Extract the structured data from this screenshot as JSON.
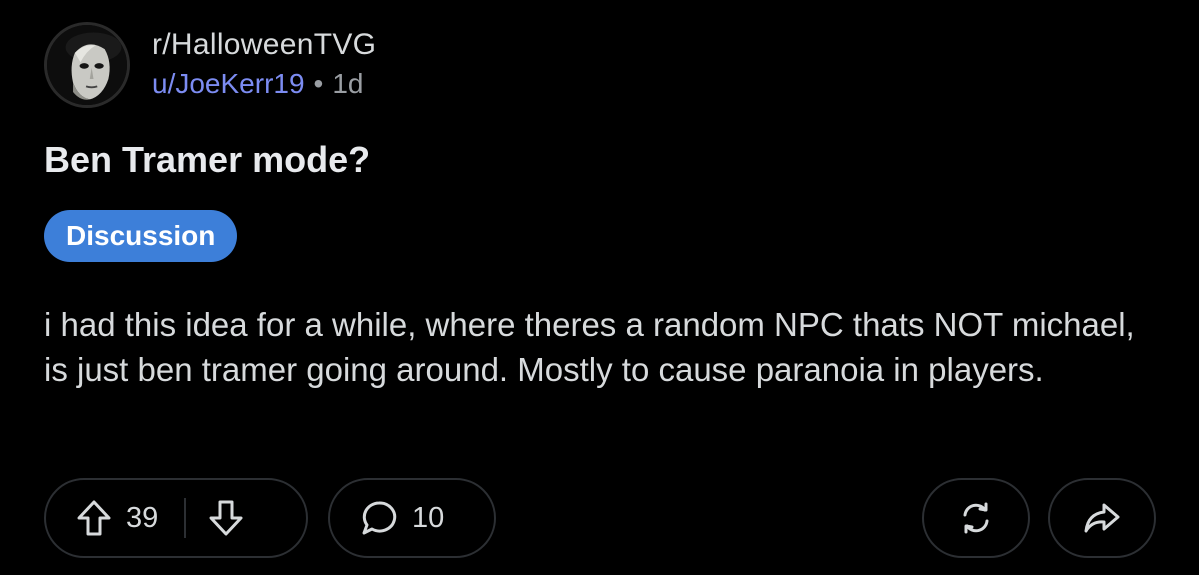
{
  "post": {
    "subreddit": "r/HalloweenTVG",
    "author": "u/JoeKerr19",
    "separator": "•",
    "age": "1d",
    "title": "Ben Tramer mode?",
    "flair": "Discussion",
    "body": "i had this idea for a while, where theres a random NPC thats NOT michael, is just ben tramer going around. Mostly to cause paranoia in players."
  },
  "actions": {
    "upvotes": "39",
    "comments": "10"
  },
  "icons": {
    "avatar": "michael-myers-mask-avatar",
    "upvote": "arrow-up-icon",
    "downvote": "arrow-down-icon",
    "comment": "speech-bubble-icon",
    "crosspost": "cycle-arrows-icon",
    "share": "share-arrow-icon"
  },
  "colors": {
    "background": "#000000",
    "username": "#7c8cf2",
    "flair_bg": "#3d7fd9",
    "text": "#d7dadc",
    "muted": "#9a9ea3"
  }
}
